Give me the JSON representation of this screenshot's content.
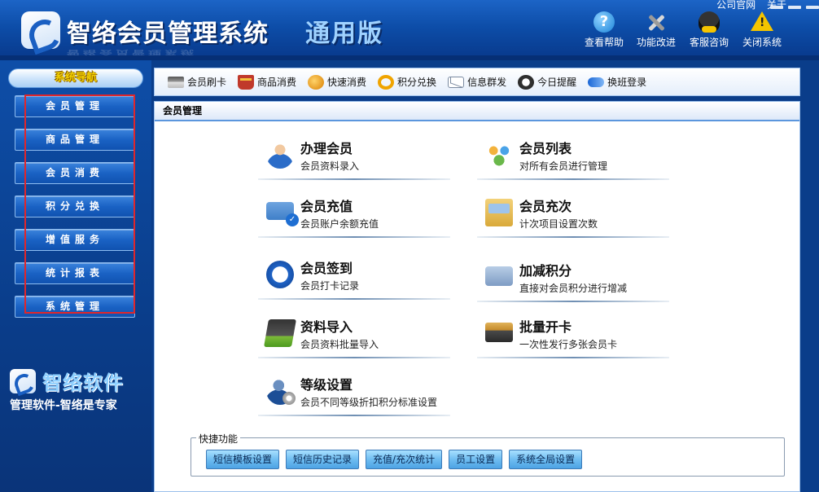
{
  "header": {
    "app_title": "智络会员管理系统",
    "app_edition": "通用版",
    "top_links": [
      "公司官网",
      "关于"
    ],
    "buttons": [
      {
        "label": "查看帮助",
        "icon": "help-icon"
      },
      {
        "label": "功能改进",
        "icon": "tools-icon"
      },
      {
        "label": "客服咨询",
        "icon": "qq-icon"
      },
      {
        "label": "关闭系统",
        "icon": "warning-icon"
      }
    ]
  },
  "sidebar": {
    "title": "系统导航",
    "items": [
      "会员管理",
      "商品管理",
      "会员消费",
      "积分兑换",
      "增值服务",
      "统计报表",
      "系统管理"
    ],
    "brand_name": "智络软件",
    "brand_slogan": "管理软件-智络是专家"
  },
  "toolbar": {
    "items": [
      {
        "label": "会员刷卡",
        "icon": "card-reader-icon"
      },
      {
        "label": "商品消费",
        "icon": "goods-icon"
      },
      {
        "label": "快速消费",
        "icon": "fast-consume-icon"
      },
      {
        "label": "积分兑换",
        "icon": "points-exchange-icon"
      },
      {
        "label": "信息群发",
        "icon": "message-icon"
      },
      {
        "label": "今日提醒",
        "icon": "clock-icon"
      },
      {
        "label": "换班登录",
        "icon": "shift-login-icon"
      }
    ]
  },
  "content": {
    "title": "会员管理",
    "functions": [
      {
        "title": "办理会员",
        "desc": "会员资料录入",
        "icon": "add-member-icon"
      },
      {
        "title": "会员列表",
        "desc": "对所有会员进行管理",
        "icon": "member-list-icon"
      },
      {
        "title": "会员充值",
        "desc": "会员账户余额充值",
        "icon": "recharge-icon"
      },
      {
        "title": "会员充次",
        "desc": "计次项目设置次数",
        "icon": "recharge-times-icon"
      },
      {
        "title": "会员签到",
        "desc": "会员打卡记录",
        "icon": "sign-in-icon"
      },
      {
        "title": "加减积分",
        "desc": "直接对会员积分进行增减",
        "icon": "adjust-points-icon"
      },
      {
        "title": "资料导入",
        "desc": "会员资料批量导入",
        "icon": "import-icon"
      },
      {
        "title": "批量开卡",
        "desc": "一次性发行多张会员卡",
        "icon": "batch-card-icon"
      },
      {
        "title": "等级设置",
        "desc": "会员不同等级折扣积分标准设置",
        "icon": "level-icon"
      }
    ],
    "quick": {
      "legend": "快捷功能",
      "buttons": [
        "短信模板设置",
        "短信历史记录",
        "充值/充次统计",
        "员工设置",
        "系统全局设置"
      ]
    }
  },
  "colors": {
    "highlight": "#e0262b",
    "nav_title_text": "#f2d000"
  }
}
